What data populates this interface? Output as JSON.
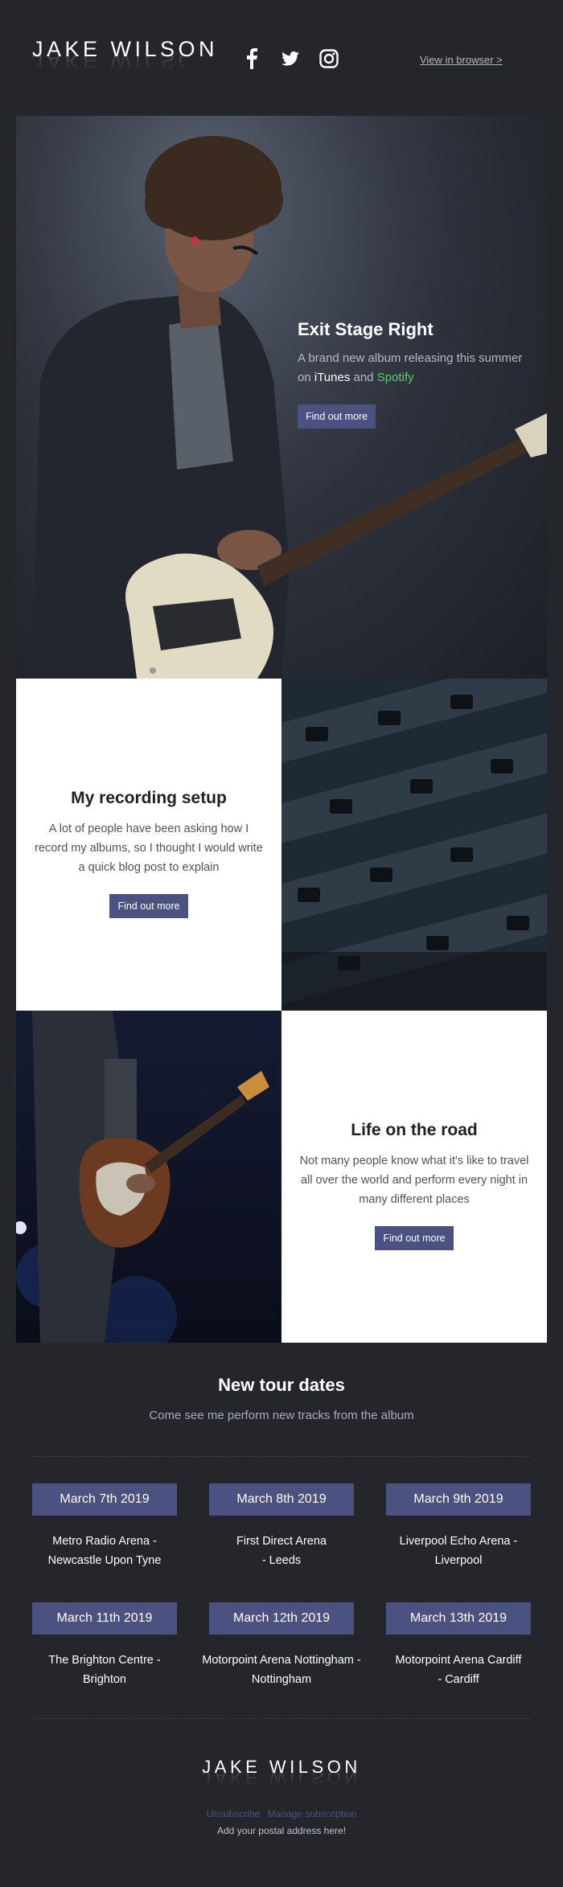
{
  "brand": {
    "name": "JAKE WILSON"
  },
  "header": {
    "social_icons": [
      "facebook-icon",
      "twitter-icon",
      "instagram-icon"
    ],
    "view_in_browser": "View in browser >"
  },
  "hero": {
    "title": "Exit Stage Right",
    "text_before": "A brand new album releasing this summer on",
    "itunes": "iTunes",
    "and": "and",
    "spotify": "Spotify",
    "button": "Find out more"
  },
  "features": [
    {
      "title": "My recording setup",
      "body": "A lot of people have been asking how I record my albums, so I thought I would write a quick blog post to explain",
      "button": "Find out more"
    },
    {
      "title": "Life on the road",
      "body": "Not many people know what it's like to travel all over the world and perform every night in many different places",
      "button": "Find out more"
    }
  ],
  "tour": {
    "title": "New tour dates",
    "subtitle": "Come see me perform new tracks from the album",
    "dates": [
      {
        "date": "March 7th 2019",
        "venue": "Metro Radio Arena - Newcastle Upon Tyne"
      },
      {
        "date": "March 8th 2019",
        "venue": "First Direct Arena - Leeds"
      },
      {
        "date": "March 9th 2019",
        "venue": "Liverpool Echo Arena - Liverpool"
      },
      {
        "date": "March 11th 2019",
        "venue": "The Brighton Centre - Brighton"
      },
      {
        "date": "March 12th 2019",
        "venue": "Motorpoint Arena Nottingham - Nottingham"
      },
      {
        "date": "March 13th 2019",
        "venue": "Motorpoint Arena Cardiff - Cardiff"
      }
    ]
  },
  "footer": {
    "unsubscribe": "Unsubscribe",
    "manage": "Manage subscription",
    "address": "Add your postal address here!"
  },
  "colors": {
    "background": "#25262c",
    "button": "#4b5180",
    "spotify": "#5ecb6c"
  }
}
